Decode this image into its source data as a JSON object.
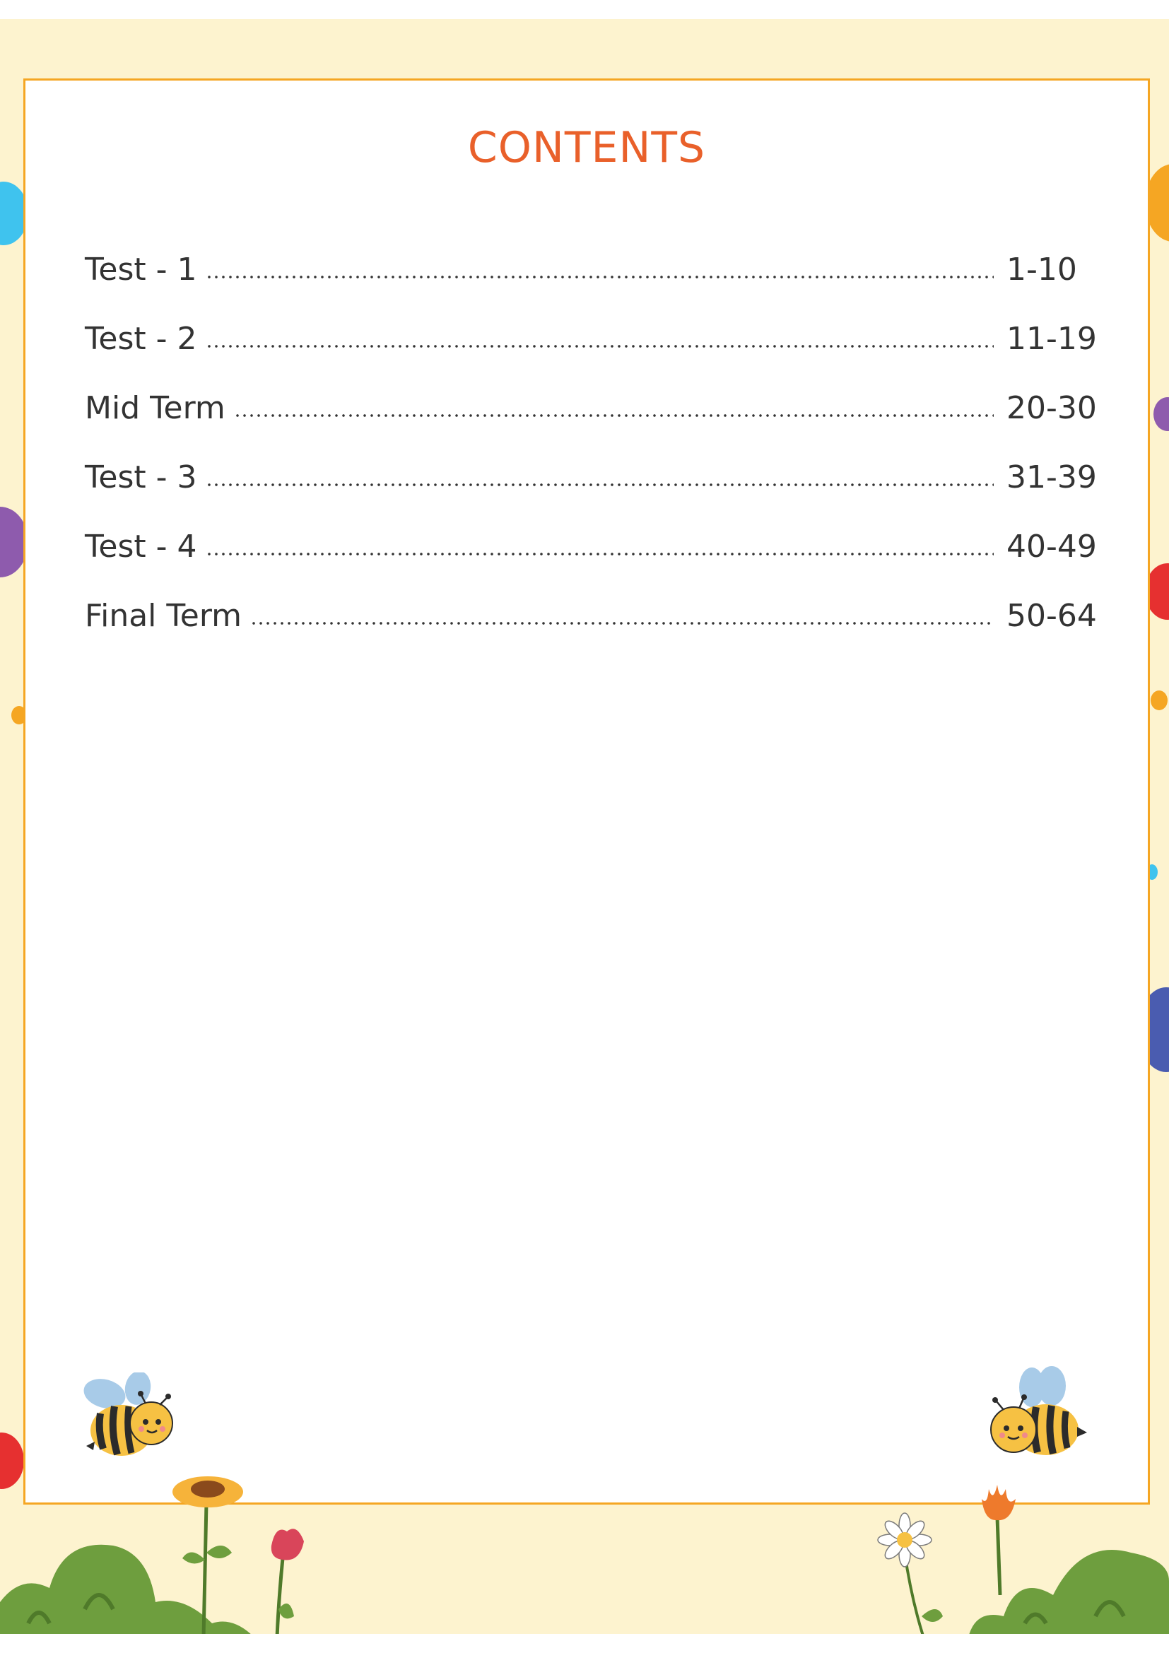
{
  "title": "CONTENTS",
  "toc": [
    {
      "label": "Test - 1",
      "pages": "1-10"
    },
    {
      "label": "Test - 2",
      "pages": "11-19"
    },
    {
      "label": "Mid Term",
      "pages": "20-30"
    },
    {
      "label": "Test - 3",
      "pages": "31-39"
    },
    {
      "label": "Test - 4",
      "pages": "40-49"
    },
    {
      "label": "Final Term",
      "pages": "50-64"
    }
  ],
  "colors": {
    "title": "#e9602a",
    "frame_border": "#f5a623",
    "background": "#fdf3cf",
    "text": "#333333"
  },
  "decorations": [
    "bee-icon",
    "sunflower-icon",
    "tulip-icon",
    "daisy-icon",
    "bush-icon",
    "polka-dot"
  ]
}
